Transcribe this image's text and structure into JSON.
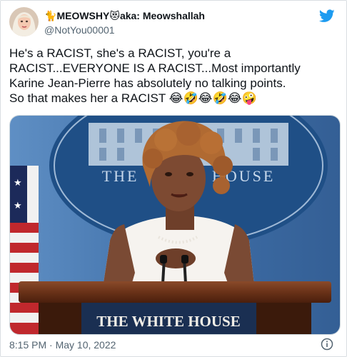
{
  "tweet": {
    "author": {
      "name_prefix": "MEOWSHY",
      "name_suffix": "aka: Meowshallah",
      "handle": "@NotYou00001"
    },
    "text_lines": [
      "He's a RACIST, she's a RACIST, you're a",
      "RACIST...EVERYONE IS A RACIST...Most importantly",
      "Karine Jean-Pierre has absolutely no talking points.",
      "So that makes her a RACIST"
    ],
    "text_emojis": "😂🤣😂🤣😂🤪",
    "media": {
      "seal_text": "THE WHITE HOUSE",
      "podium_text": "THE WHITE HOUSE"
    },
    "timestamp": "8:15 PM · May 10, 2022"
  },
  "icons": {
    "name_emoji_1": "🐈",
    "name_emoji_2": "😻",
    "logo": "twitter-bird-icon",
    "info": "info-icon"
  },
  "colors": {
    "twitter_blue": "#1d9bf0",
    "text": "#0f1419",
    "muted": "#536471"
  }
}
